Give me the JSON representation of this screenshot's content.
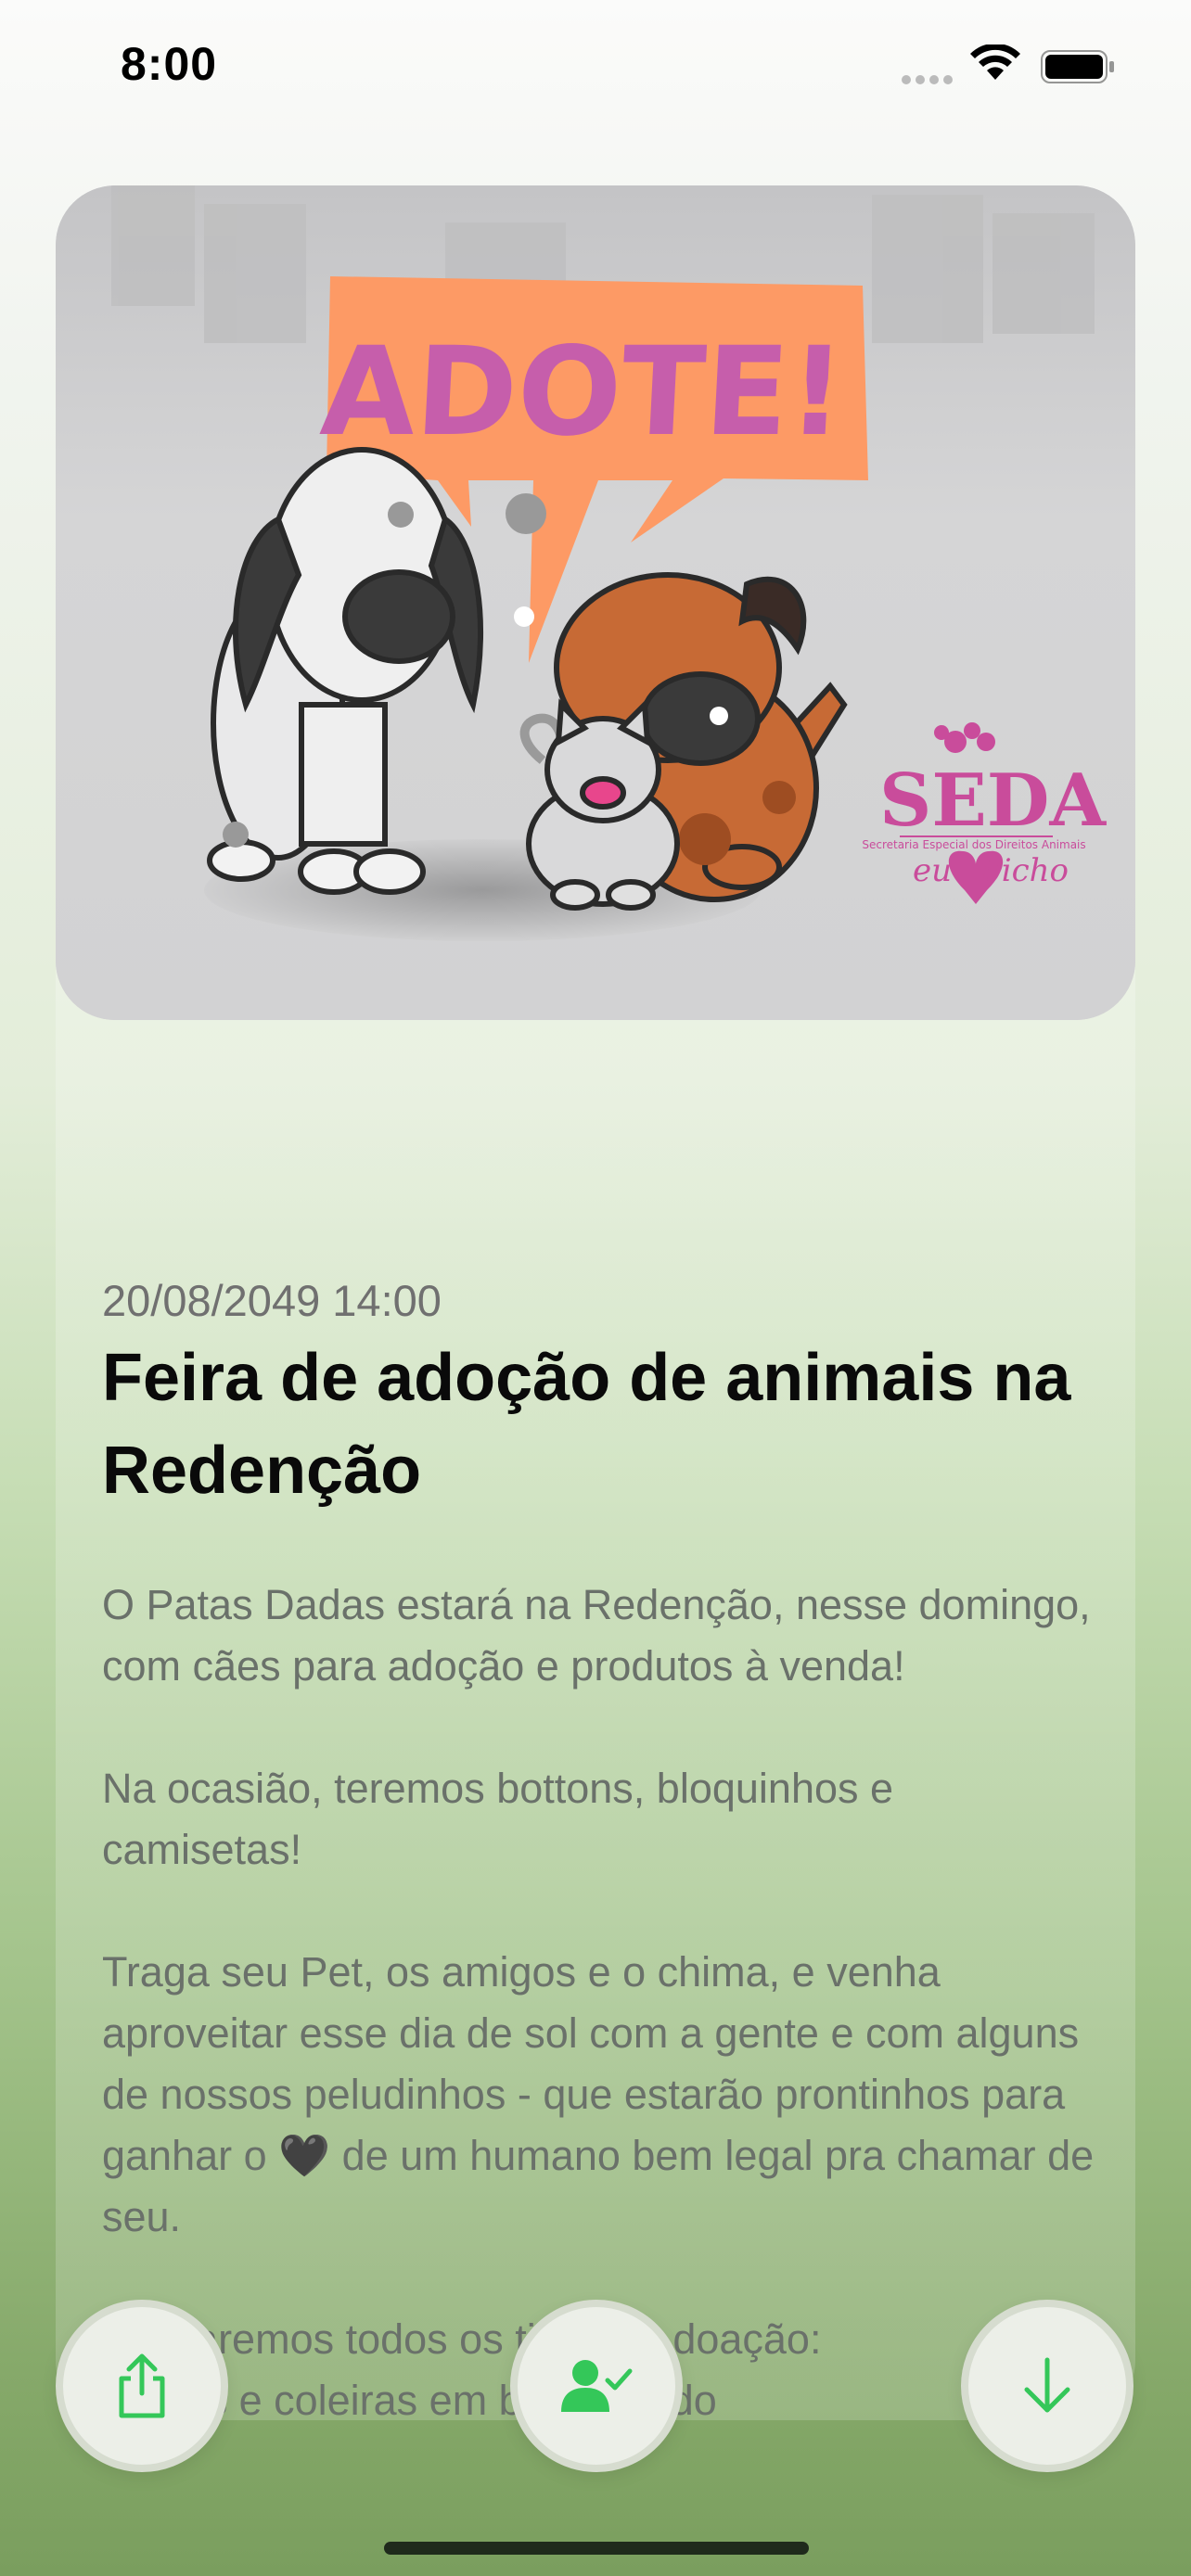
{
  "status_bar": {
    "time": "8:00"
  },
  "hero": {
    "headline": "ADOTE!",
    "logo_org": "SEDA",
    "logo_subtitle": "Secretaria Especial dos Direitos Animais",
    "logo_tagline_left": "eu",
    "logo_tagline_right": "bicho"
  },
  "event": {
    "datetime": "20/08/2049 14:00",
    "title": "Feira de adoção de animais na Redenção",
    "description": "O Patas Dadas estará na Redenção, nesse domingo, com cães para adoção e produtos à venda!\n\nNa ocasião, teremos bottons, bloquinhos e camisetas!\n\nTraga seu Pet, os amigos e o chima, e venha aproveitar esse dia de sol com a gente e com alguns de nossos peludinhos - que estarão prontinhos para ganhar o 🖤 de um humano bem legal pra chamar de seu.\n\nAceitaremos todos os tipos de doação:\n- guias e coleiras em bom estado\n- ração (as que mais precisamos no momento são sênior e filhote)"
  },
  "actions": {
    "share_icon": "share-icon",
    "adopt_icon": "person-check-icon",
    "download_icon": "arrow-down-icon"
  },
  "colors": {
    "accent": "#34c759",
    "headline": "#c65eab",
    "bubble": "#fd9a65"
  }
}
